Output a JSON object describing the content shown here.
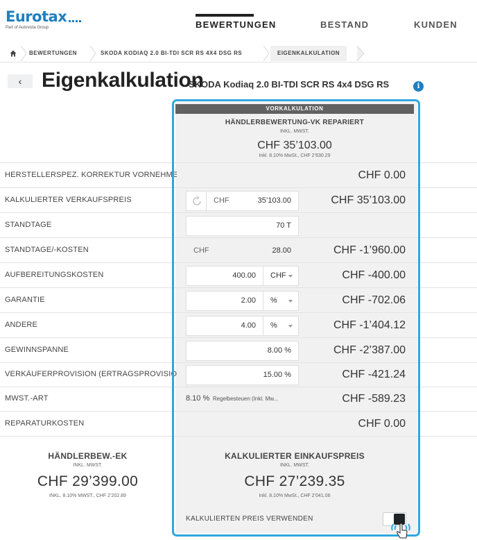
{
  "header": {
    "logo_text": "Eurotax",
    "logo_sub": "Part of Autovista Group",
    "nav": [
      {
        "label": "BEWERTUNGEN",
        "active": true
      },
      {
        "label": "BESTAND",
        "active": false
      },
      {
        "label": "KUNDEN",
        "active": false
      }
    ]
  },
  "breadcrumb": [
    "BEWERTUNGEN",
    "SKODA KODIAQ 2.0 BI-TDI SCR RS 4X4 DSG RS",
    "EIGENKALKULATION"
  ],
  "title": {
    "main": "Eigenkalkulation",
    "sub": "SKODA Kodiaq 2.0 BI-TDI SCR RS 4x4 DSG RS",
    "back": "‹",
    "info": "i"
  },
  "column": {
    "header": "VORKALKULATION",
    "hb_title": "HÄNDLERBEWERTUNG-VK REPARIERT",
    "hb_sub": "INKL. MWST.",
    "hb_value": "CHF 35’103.00",
    "hb_note": "Inkl. 8.10% MwSt., CHF 2’630.29"
  },
  "rows": [
    {
      "label": "HERSTELLERSPEZ. KORREKTUR VORNEHMEN",
      "value": "CHF 0.00"
    },
    {
      "label": "KALKULIERTER VERKAUFSPREIS",
      "input_cur": "CHF",
      "input_val": "35’103.00",
      "value": "CHF 35’103.00"
    },
    {
      "label": "STANDTAGE",
      "input_val": "70 T",
      "value": ""
    },
    {
      "label": "STANDTAGE/-KOSTEN",
      "input_cur": "CHF",
      "input_val": "28.00",
      "value": "CHF -1’960.00"
    },
    {
      "label": "AUFBEREITUNGSKOSTEN",
      "input_val": "400.00",
      "select": "CHF",
      "value": "CHF -400.00"
    },
    {
      "label": "GARANTIE",
      "input_val": "2.00",
      "select": "%",
      "value": "CHF -702.06"
    },
    {
      "label": "ANDERE",
      "input_val": "4.00",
      "select": "%",
      "value": "CHF -1’404.12"
    },
    {
      "label": "GEWINNSPANNE",
      "input_val": "8.00 %",
      "value": "CHF -2’387.00"
    },
    {
      "label": "VERKÄUFERPROVISION (ERTRAGSPROVISION)",
      "input_val": "15.00 %",
      "value": "CHF -421.24"
    },
    {
      "label": "MWST.-ART",
      "mwst_pct": "8.10 %",
      "mwst_text": "Regelbesteuen (Inkl. Mw...",
      "value": "CHF -589.23"
    },
    {
      "label": "REPARATURKOSTEN",
      "value": "CHF 0.00"
    }
  ],
  "summary_left": {
    "title": "HÄNDLERBEW.-EK",
    "sub": "INKL. MWST.",
    "value": "CHF 29’399.00",
    "note": "INKL. 8.10% MWST., CHF 2’202.89"
  },
  "summary_right": {
    "title": "KALKULIERTER EINKAUFSPREIS",
    "sub": "INKL. MWST.",
    "value": "CHF 27’239.35",
    "note": "Inkl. 8.10% MwSt., CHF 2’041.06",
    "toggle_label": "KALKULIERTEN PREIS VERWENDEN",
    "toggle_on": true
  },
  "colors": {
    "accent": "#1f7fc0",
    "highlight_border": "#2fa6df",
    "column_bg": "#f1f1f1",
    "column_header": "#616161"
  },
  "icons": [
    "home-icon",
    "info-icon",
    "reset-icon",
    "chevron-left-icon",
    "caret-down-icon",
    "hand-cursor-icon"
  ]
}
